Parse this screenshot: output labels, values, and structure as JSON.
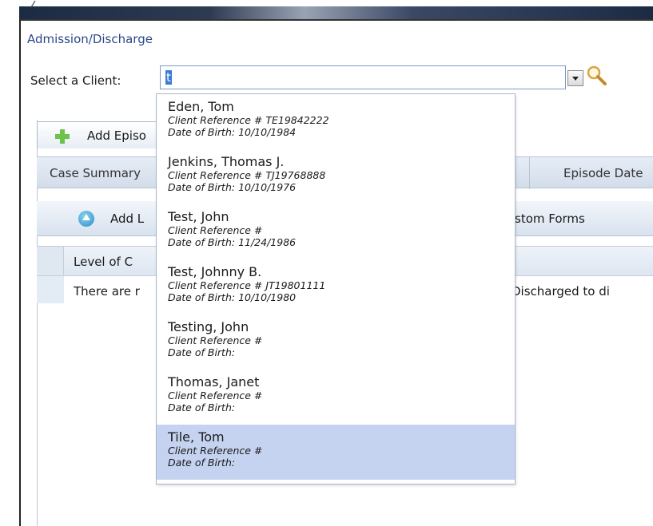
{
  "page_title": "Admission/Discharge",
  "client_selector": {
    "label": "Select a Client:",
    "input_value": "t"
  },
  "actions": {
    "add_episode_label": "Add Episo",
    "add_level_label": "Add L",
    "custom_forms_label": "stom Forms"
  },
  "tabs": {
    "case_summary": "Case Summary",
    "episode_dates": "Episode Date"
  },
  "grid": {
    "level_header": "Level of C",
    "empty_message": "There are r",
    "empty_message_tail": "e Discharged to di"
  },
  "suggestions": [
    {
      "name": "Eden, Tom",
      "ref": "Client Reference # TE19842222",
      "dob": "Date of Birth: 10/10/1984",
      "selected": false
    },
    {
      "name": "Jenkins, Thomas J.",
      "ref": "Client Reference # TJ19768888",
      "dob": "Date of Birth: 10/10/1976",
      "selected": false
    },
    {
      "name": "Test, John",
      "ref": "Client Reference #",
      "dob": "Date of Birth: 11/24/1986",
      "selected": false
    },
    {
      "name": "Test, Johnny B.",
      "ref": "Client Reference # JT19801111",
      "dob": "Date of Birth: 10/10/1980",
      "selected": false
    },
    {
      "name": "Testing, John",
      "ref": "Client Reference #",
      "dob": "Date of Birth:",
      "selected": false
    },
    {
      "name": "Thomas, Janet",
      "ref": "Client Reference #",
      "dob": "Date of Birth:",
      "selected": false
    },
    {
      "name": "Tile, Tom",
      "ref": "Client Reference #",
      "dob": "Date of Birth:",
      "selected": true
    }
  ],
  "colors": {
    "title_blue": "#2a4a8a",
    "selection": "#c5d3f1",
    "input_border": "#7a9cc8",
    "header_dark": "#1c2b44"
  },
  "icons": {
    "search": "magnifier-icon",
    "add_episode": "plus-icon",
    "add_level": "up-arrow-icon",
    "dropdown": "chevron-down-icon"
  }
}
